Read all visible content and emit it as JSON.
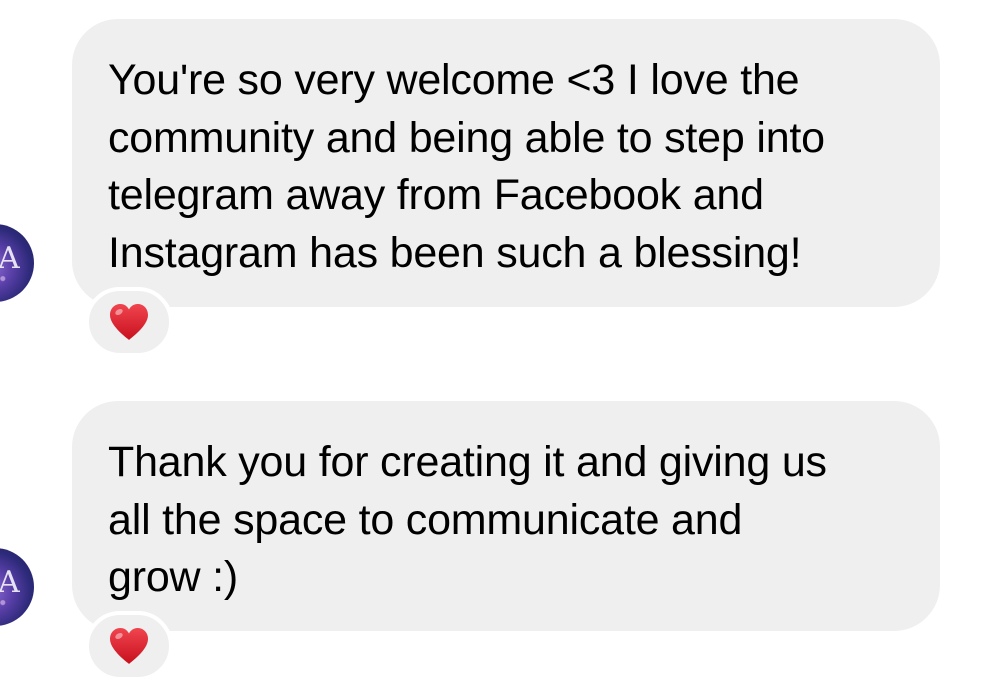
{
  "conversation": {
    "messages": [
      {
        "lines": [
          "You're so very welcome <3 I love the",
          "community and being able to step into",
          "telegram away from Facebook and",
          "Instagram has been such a blessing!"
        ],
        "reaction": "❤️"
      },
      {
        "lines": [
          "Thank you for creating it and giving us",
          "all the space to communicate and",
          "grow :)"
        ],
        "reaction": "❤️"
      }
    ],
    "avatar": {
      "letter": "A"
    }
  },
  "icons": {
    "reaction_icon": "red-heart-icon",
    "reaction_color": "#e0212e",
    "bubble_color": "#efefef"
  }
}
